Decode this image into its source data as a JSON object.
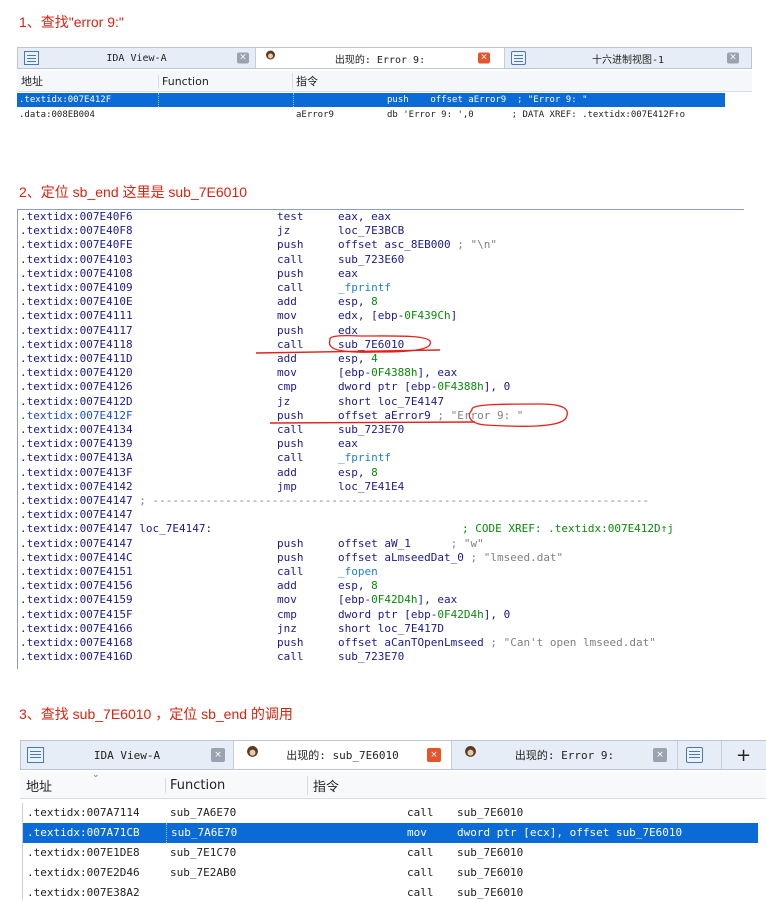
{
  "steps": {
    "s1": "1、查找\"error 9:\"",
    "s2": "2、定位 sb_end  这里是  sub_7E6010",
    "s3": "3、查找 sub_7E6010 ，定位 sb_end 的调用"
  },
  "panel1": {
    "tabs": [
      {
        "icon": "list-icon",
        "title": "IDA View-A",
        "active": false
      },
      {
        "icon": "face-icon",
        "title": "出现的: Error 9:",
        "active": true
      },
      {
        "icon": "hex-icon",
        "title": "十六进制视图-1",
        "active": false
      }
    ],
    "columns": [
      "地址",
      "Function",
      "指令"
    ],
    "rows": [
      {
        "addr": ".textidx:007E412F",
        "func": "",
        "a": "",
        "b": "push    offset aError9  ; \"Error 9: \"",
        "selected": true
      },
      {
        "addr": ".data:008EB004",
        "func": "",
        "a": "aError9",
        "b": "db 'Error 9: ',0       ; DATA XREF: .textidx:007E412F↑o",
        "selected": false
      }
    ]
  },
  "disasm": {
    "lines": [
      {
        "addr": ".textidx:007E40F6",
        "mn": "test",
        "op": "eax, eax"
      },
      {
        "addr": ".textidx:007E40F8",
        "mn": "jz",
        "op": "loc_7E3BCB"
      },
      {
        "addr": ".textidx:007E40FE",
        "mn": "push",
        "op": "offset asc_8EB000",
        "cmt": " ; \"\\n\""
      },
      {
        "addr": ".textidx:007E4103",
        "mn": "call",
        "op": "sub_723E60"
      },
      {
        "addr": ".textidx:007E4108",
        "mn": "push",
        "op": "eax"
      },
      {
        "addr": ".textidx:007E4109",
        "mn": "call",
        "op": "_fprintf",
        "fn": true
      },
      {
        "addr": ".textidx:007E410E",
        "mn": "add",
        "op": "esp, ",
        "num": "8"
      },
      {
        "addr": ".textidx:007E4111",
        "mn": "mov",
        "op": "edx, [ebp-",
        "num": "0F439Ch",
        "tail": "]"
      },
      {
        "addr": ".textidx:007E4117",
        "mn": "push",
        "op": "edx"
      },
      {
        "addr": ".textidx:007E4118",
        "mn": "call",
        "op": "sub_7E6010"
      },
      {
        "addr": ".textidx:007E411D",
        "mn": "add",
        "op": "esp, ",
        "num": "4"
      },
      {
        "addr": ".textidx:007E4120",
        "mn": "mov",
        "op": "[ebp-",
        "num": "0F4388h",
        "tail": "], eax"
      },
      {
        "addr": ".textidx:007E4126",
        "mn": "cmp",
        "op": "dword ptr [ebp-",
        "num": "0F4388h",
        "tail": "], 0"
      },
      {
        "addr": ".textidx:007E412D",
        "mn": "jz",
        "op": "short loc_7E4147"
      },
      {
        "addr": ".textidx:007E412F",
        "mn": "push",
        "op": "offset aError9",
        "cmt": " ; \"Error 9: \"",
        "hl": true
      },
      {
        "addr": ".textidx:007E4134",
        "mn": "call",
        "op": "sub_723E70"
      },
      {
        "addr": ".textidx:007E4139",
        "mn": "push",
        "op": "eax"
      },
      {
        "addr": ".textidx:007E413A",
        "mn": "call",
        "op": "_fprintf",
        "fn": true
      },
      {
        "addr": ".textidx:007E413F",
        "mn": "add",
        "op": "esp, ",
        "num": "8"
      },
      {
        "addr": ".textidx:007E4142",
        "mn": "jmp",
        "op": "loc_7E41E4"
      },
      {
        "addr": ".textidx:007E4147",
        "sep": " ; ---------------------------------------------------------------------------"
      },
      {
        "addr": ".textidx:007E4147"
      },
      {
        "addr": ".textidx:007E4147",
        "label": " loc_7E4147:",
        "xref": "; CODE XREF: .textidx:007E412D↑j"
      },
      {
        "addr": ".textidx:007E4147",
        "mn": "push",
        "op": "offset aW_1",
        "cmt": "      ; \"w\""
      },
      {
        "addr": ".textidx:007E414C",
        "mn": "push",
        "op": "offset aLmseedDat_0",
        "cmt": " ; \"lmseed.dat\""
      },
      {
        "addr": ".textidx:007E4151",
        "mn": "call",
        "op": "_fopen",
        "fn": true
      },
      {
        "addr": ".textidx:007E4156",
        "mn": "add",
        "op": "esp, ",
        "num": "8"
      },
      {
        "addr": ".textidx:007E4159",
        "mn": "mov",
        "op": "[ebp-",
        "num": "0F42D4h",
        "tail": "], eax"
      },
      {
        "addr": ".textidx:007E415F",
        "mn": "cmp",
        "op": "dword ptr [ebp-",
        "num": "0F42D4h",
        "tail": "], 0"
      },
      {
        "addr": ".textidx:007E4166",
        "mn": "jnz",
        "op": "short loc_7E417D"
      },
      {
        "addr": ".textidx:007E4168",
        "mn": "push",
        "op": "offset aCanTOpenLmseed",
        "cmt": " ; \"Can't open lmseed.dat\""
      },
      {
        "addr": ".textidx:007E416D",
        "mn": "call",
        "op": "sub_723E70"
      }
    ]
  },
  "panel3": {
    "tabs": [
      {
        "icon": "list-icon",
        "title": "IDA View-A",
        "active": false
      },
      {
        "icon": "face-icon",
        "title": "出现的: sub_7E6010",
        "active": true
      },
      {
        "icon": "face-icon",
        "title": "出现的: Error 9:",
        "active": false
      },
      {
        "icon": "hex-icon",
        "title": "",
        "active": false
      }
    ],
    "plus": "+",
    "columns": [
      "地址",
      "Function",
      "指令"
    ],
    "rows": [
      {
        "addr": ".textidx:007A7114",
        "func": "sub_7A6E70",
        "a": "call",
        "b": "sub_7E6010",
        "selected": false
      },
      {
        "addr": ".textidx:007A71CB",
        "func": "sub_7A6E70",
        "a": "mov",
        "b": "dword ptr [ecx], offset sub_7E6010",
        "selected": true
      },
      {
        "addr": ".textidx:007E1DE8",
        "func": "sub_7E1C70",
        "a": "call",
        "b": "sub_7E6010",
        "selected": false
      },
      {
        "addr": ".textidx:007E2D46",
        "func": "sub_7E2AB0",
        "a": "call",
        "b": "sub_7E6010",
        "selected": false
      },
      {
        "addr": ".textidx:007E38A2",
        "func": "",
        "a": "call",
        "b": "sub_7E6010",
        "selected": false
      }
    ]
  },
  "colors": {
    "step": "#d9230f",
    "selection": "#0a6ad6",
    "annotation": "#e0241b",
    "number": "#0a8a0a"
  }
}
